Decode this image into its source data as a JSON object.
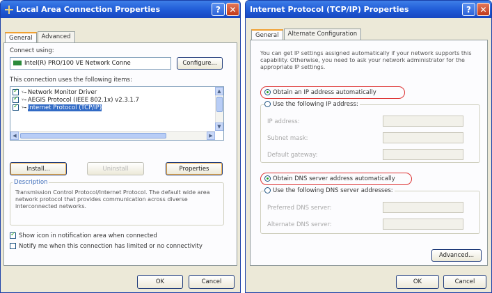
{
  "left": {
    "title": "Local Area Connection Properties",
    "help_glyph": "?",
    "close_glyph": "✕",
    "tabs": [
      "General",
      "Advanced"
    ],
    "connect_using_label": "Connect using:",
    "adapter_name": "Intel(R) PRO/100 VE Network Conne",
    "configure_label": "Configure...",
    "items_label": "This connection uses the following items:",
    "items": [
      {
        "label": "Network Monitor Driver",
        "checked": true,
        "selected": false
      },
      {
        "label": "AEGIS Protocol (IEEE 802.1x) v2.3.1.7",
        "checked": true,
        "selected": false
      },
      {
        "label": "Internet Protocol (TCP/IP)",
        "checked": true,
        "selected": true
      }
    ],
    "install_label": "Install...",
    "uninstall_label": "Uninstall",
    "properties_label": "Properties",
    "description_title": "Description",
    "description_text": "Transmission Control Protocol/Internet Protocol. The default wide area network protocol that provides communication across diverse interconnected networks.",
    "show_icon_label": "Show icon in notification area when connected",
    "show_icon_checked": true,
    "notify_label": "Notify me when this connection has limited or no connectivity",
    "notify_checked": false,
    "ok_label": "OK",
    "cancel_label": "Cancel"
  },
  "right": {
    "title": "Internet Protocol (TCP/IP) Properties",
    "help_glyph": "?",
    "close_glyph": "✕",
    "tabs": [
      "General",
      "Alternate Configuration"
    ],
    "intro_text": "You can get IP settings assigned automatically if your network supports this capability. Otherwise, you need to ask your network administrator for the appropriate IP settings.",
    "obtain_ip_label": "Obtain an IP address automatically",
    "use_ip_label": "Use the following IP address:",
    "ip_address_label": "IP address:",
    "subnet_label": "Subnet mask:",
    "gateway_label": "Default gateway:",
    "obtain_dns_label": "Obtain DNS server address automatically",
    "use_dns_label": "Use the following DNS server addresses:",
    "preferred_dns_label": "Preferred DNS server:",
    "alternate_dns_label": "Alternate DNS server:",
    "advanced_label": "Advanced...",
    "ok_label": "OK",
    "cancel_label": "Cancel"
  },
  "colors": {
    "title_bar": "#1f5ad6",
    "highlight_circle": "#dd3333",
    "selection": "#316ac5",
    "dialog_bg": "#ece9d8"
  }
}
